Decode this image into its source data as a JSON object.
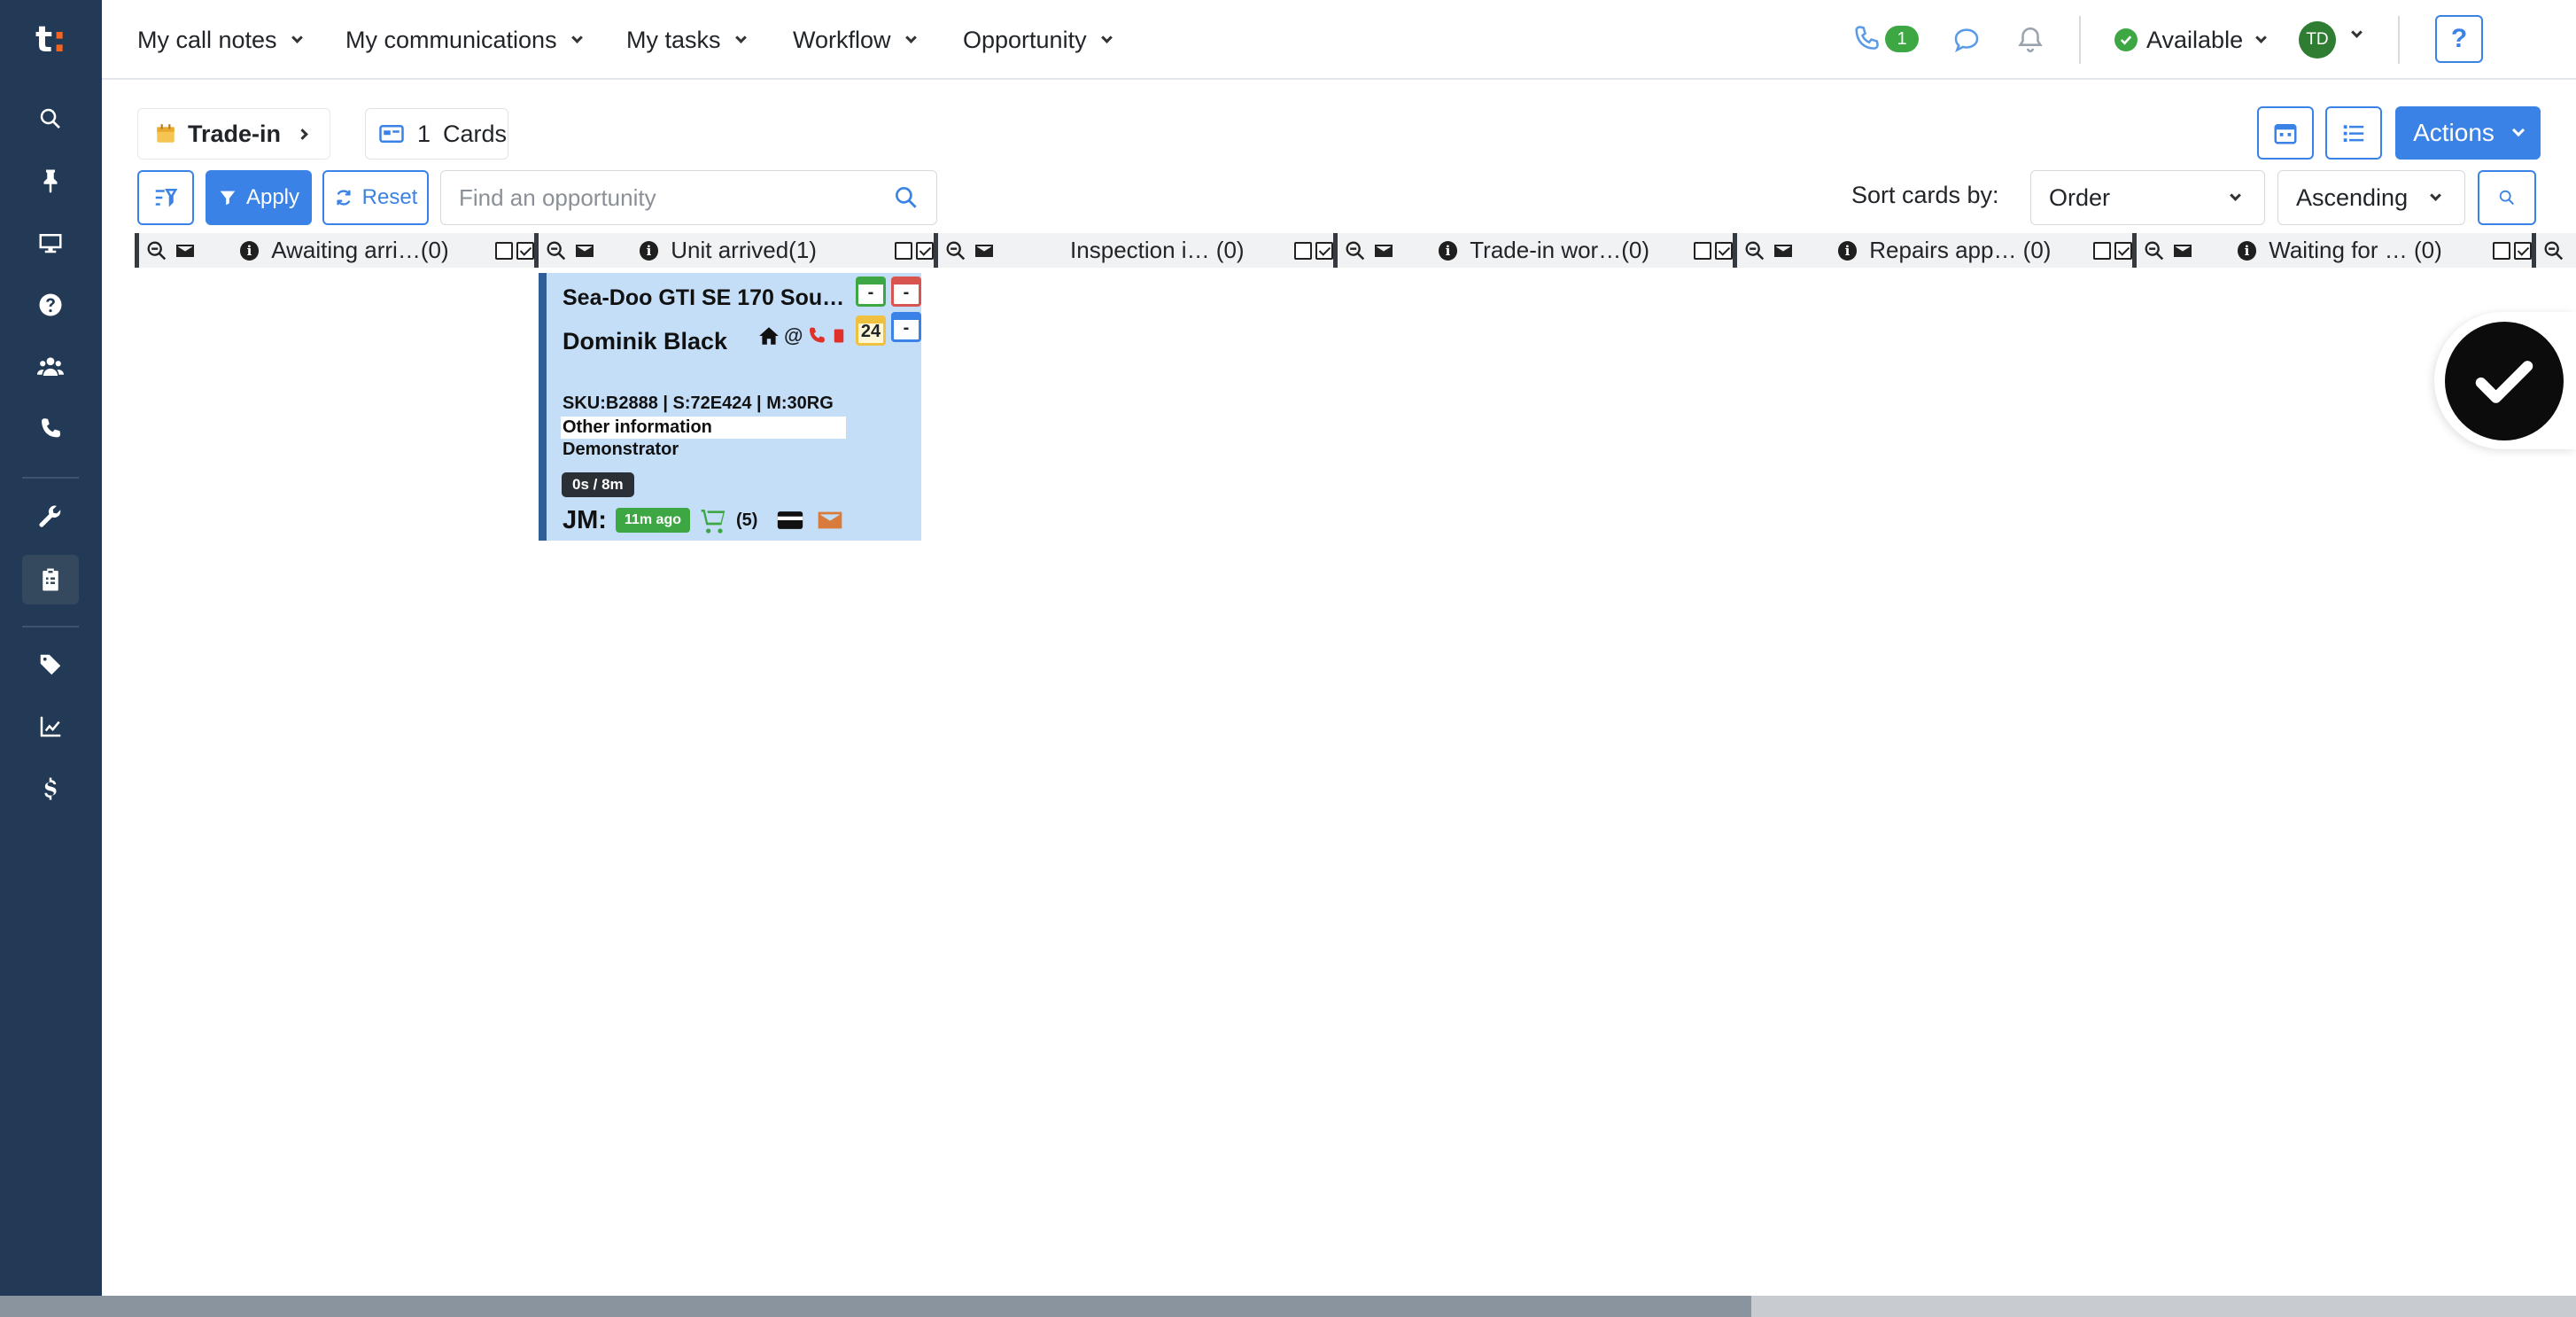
{
  "brand": {
    "logo_letter": "t",
    "logo_dot": ":"
  },
  "nav": {
    "items": [
      {
        "label": "My call notes"
      },
      {
        "label": "My communications"
      },
      {
        "label": "My tasks"
      },
      {
        "label": "Workflow"
      },
      {
        "label": "Opportunity"
      }
    ]
  },
  "header": {
    "call_count": "1",
    "status": "Available",
    "avatar_initials": "TD",
    "help_label": "?"
  },
  "toolbar": {
    "breadcrumb": "Trade-in",
    "cards_count": "1",
    "cards_label": "Cards",
    "actions_label": "Actions",
    "apply_label": "Apply",
    "reset_label": "Reset",
    "search_placeholder": "Find an opportunity",
    "sort_label": "Sort cards by:",
    "sort_value": "Order",
    "order_value": "Ascending"
  },
  "columns": [
    {
      "title": "Awaiting arri…(0)"
    },
    {
      "title": "Unit arrived(1)"
    },
    {
      "title": "Inspection i…  (0)"
    },
    {
      "title": "Trade-in wor…(0)"
    },
    {
      "title": "Repairs app… (0)"
    },
    {
      "title": "Waiting for … (0)"
    }
  ],
  "card": {
    "title": "Sea-Doo GTI SE 170 Soun…",
    "customer": "Dominik Black",
    "contact_at": "@",
    "cal_green": "-",
    "cal_red": "-",
    "cal_yellow": "24",
    "cal_blue": "-",
    "sku_line": "SKU:B2888 | S:72E424 | M:30RG",
    "other_info": "Other information",
    "demo": "Demonstrator",
    "time": "0s / 8m",
    "initials": "JM:",
    "ago": "11m ago",
    "cart_count": "(5)"
  },
  "colors": {
    "sidebar": "#233a56",
    "accent": "#3b82e6",
    "card_bg": "#c5def8",
    "green": "#3da843"
  },
  "scroll": {
    "horizontal_fraction": 0.68
  }
}
